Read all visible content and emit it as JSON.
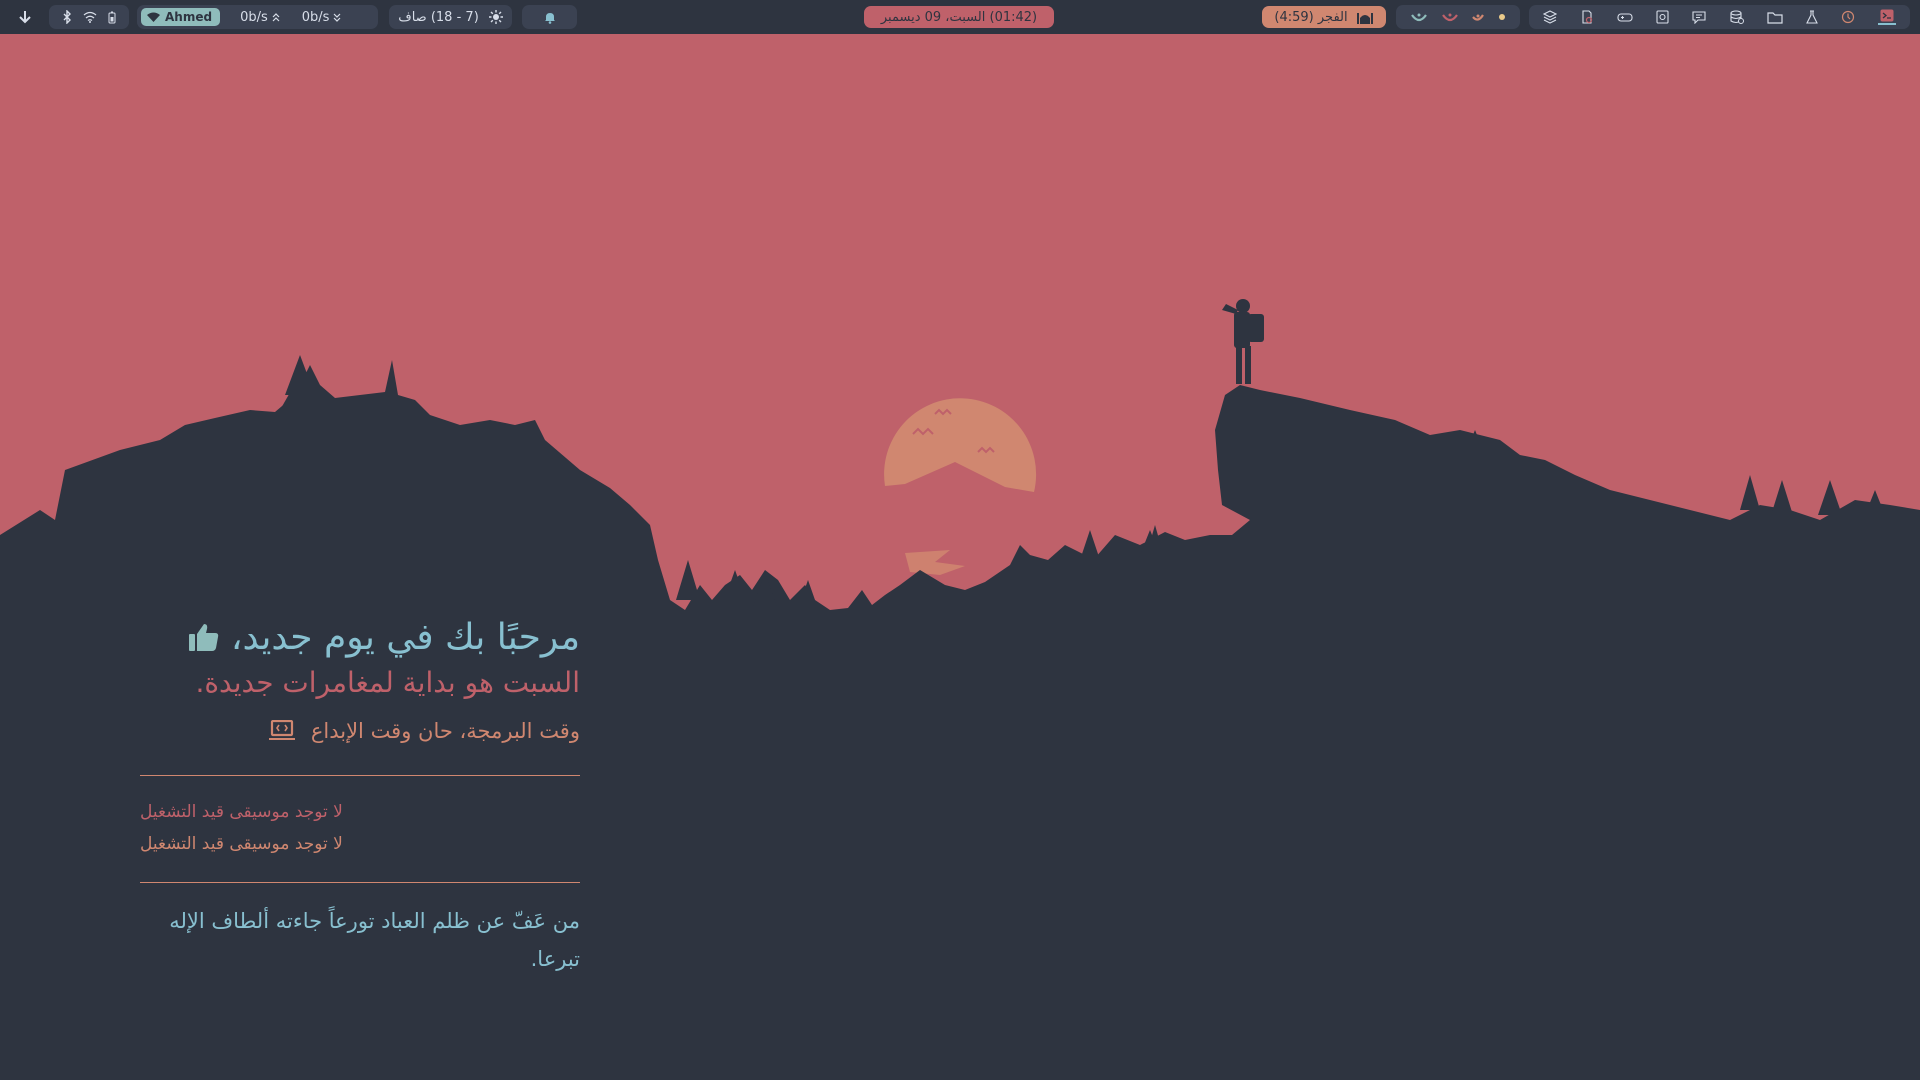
{
  "colors": {
    "sky": "#bf616a",
    "ground": "#2e3440",
    "sun": "#d08770",
    "teal": "#88c0d0",
    "green": "#8fbcbb",
    "red": "#bf616a",
    "orange": "#d08770",
    "yellow": "#ebcb8b"
  },
  "topbar": {
    "left": {
      "download_icon": "arrow-down-icon",
      "system_icons": [
        "bluetooth-icon",
        "wifi-icon",
        "battery-icon"
      ],
      "network": {
        "wifi_name": "Ahmed",
        "upload": "0b/s",
        "download": "0b/s"
      },
      "weather": {
        "text": "(7 - 18) صاف",
        "icon": "sun-icon"
      },
      "notification_icon": "bell-icon"
    },
    "clock": "(01:42) السبت، 09 ديسمبر",
    "prayer": {
      "text": "الفجر (4:59)",
      "icon": "mosque-icon"
    },
    "faces": [
      "face-icon",
      "face-icon",
      "face-icon",
      "dot-icon"
    ],
    "apps": [
      "layers-icon",
      "gnome-builder-icon",
      "gamepad-icon",
      "screenshot-icon",
      "chat-icon",
      "database-icon",
      "folder-icon",
      "flask-icon",
      "settings-icon",
      "terminal-icon"
    ]
  },
  "welcome": {
    "greeting": "مرحبًا بك في يوم جديد،",
    "subtitle": "السبت هو بداية لمغامرات جديدة.",
    "tagline": "وقت البرمجة، حان وقت الإبداع"
  },
  "music": {
    "line1": "لا توجد موسيقى قيد التشغيل",
    "line2": "لا توجد موسيقى قيد التشغيل"
  },
  "quote": {
    "line1": "من عَفّ عن ظلم العباد تورعاً جاءته ألطاف الإله",
    "line2": "تبرعا."
  }
}
